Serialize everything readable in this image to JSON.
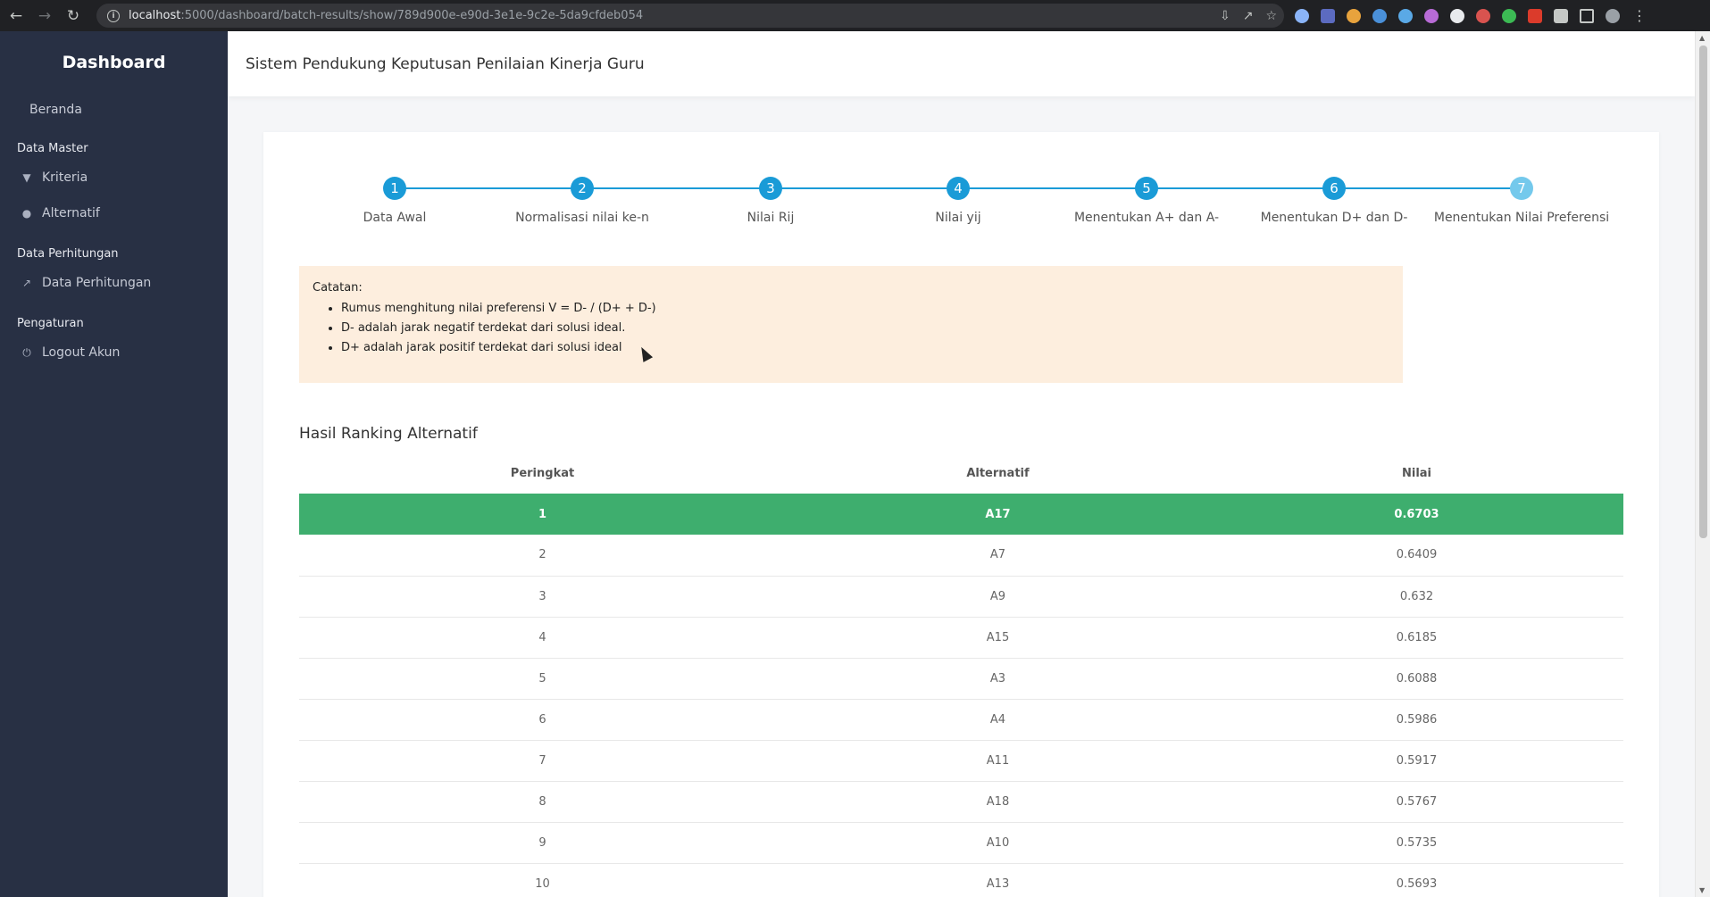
{
  "browser": {
    "url_host": "localhost",
    "url_path": ":5000/dashboard/batch-results/show/789d900e-e90d-3e1e-9c2e-5da9cfdeb054"
  },
  "sidebar": {
    "brand": "Dashboard",
    "home": "Beranda",
    "section_master": "Data Master",
    "item_kriteria": "Kriteria",
    "item_alternatif": "Alternatif",
    "section_perhitungan": "Data Perhitungan",
    "item_perhitungan": "Data Perhitungan",
    "section_pengaturan": "Pengaturan",
    "item_logout": "Logout Akun"
  },
  "header": {
    "title": "Sistem Pendukung Keputusan Penilaian Kinerja Guru"
  },
  "steps": [
    {
      "num": "1",
      "label": "Data Awal"
    },
    {
      "num": "2",
      "label": "Normalisasi nilai ke-n"
    },
    {
      "num": "3",
      "label": "Nilai Rij"
    },
    {
      "num": "4",
      "label": "Nilai yij"
    },
    {
      "num": "5",
      "label": "Menentukan A+ dan A-"
    },
    {
      "num": "6",
      "label": "Menentukan D+ dan D-"
    },
    {
      "num": "7",
      "label": "Menentukan Nilai Preferensi"
    }
  ],
  "note": {
    "title": "Catatan:",
    "items": [
      "Rumus menghitung nilai preferensi V = D- / (D+ + D-)",
      "D- adalah jarak negatif terdekat dari solusi ideal.",
      "D+ adalah jarak positif terdekat dari solusi ideal"
    ]
  },
  "ranking": {
    "title": "Hasil Ranking Alternatif",
    "headers": [
      "Peringkat",
      "Alternatif",
      "Nilai"
    ],
    "rows": [
      [
        "1",
        "A17",
        "0.6703"
      ],
      [
        "2",
        "A7",
        "0.6409"
      ],
      [
        "3",
        "A9",
        "0.632"
      ],
      [
        "4",
        "A15",
        "0.6185"
      ],
      [
        "5",
        "A3",
        "0.6088"
      ],
      [
        "6",
        "A4",
        "0.5986"
      ],
      [
        "7",
        "A11",
        "0.5917"
      ],
      [
        "8",
        "A18",
        "0.5767"
      ],
      [
        "9",
        "A10",
        "0.5735"
      ],
      [
        "10",
        "A13",
        "0.5693"
      ]
    ]
  },
  "colors": {
    "sidebar": "#283044",
    "accent": "#1a9bd7",
    "highlight_row": "#3eae6e",
    "note_bg": "#fdeede"
  }
}
